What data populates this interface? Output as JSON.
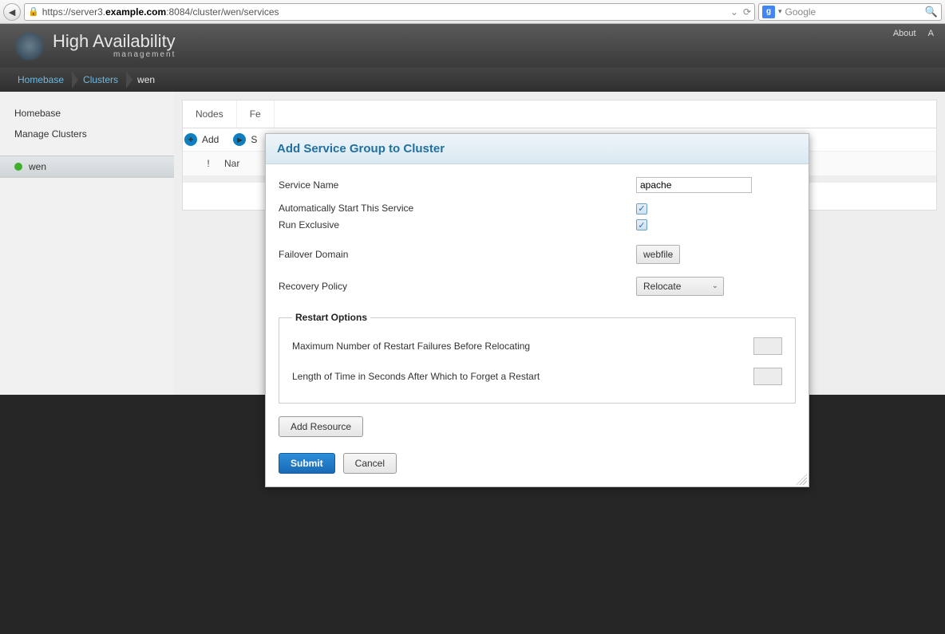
{
  "browser": {
    "url_prefix": "https://",
    "url_host_pre": "server3.",
    "url_host_bold": "example.com",
    "url_rest": ":8084/cluster/wen/services",
    "search_engine": "g",
    "search_placeholder": "Google"
  },
  "header": {
    "title": "High Availability",
    "subtitle": "management",
    "links": [
      "About",
      "A"
    ]
  },
  "breadcrumbs": [
    "Homebase",
    "Clusters",
    "wen"
  ],
  "sidebar": {
    "items": [
      "Homebase",
      "Manage Clusters"
    ],
    "cluster": "wen"
  },
  "tabs": [
    "Nodes",
    "Fe"
  ],
  "toolbar": {
    "add_label": "Add",
    "start_label": "S"
  },
  "table": {
    "col_bang": "!",
    "col_name": "Nar"
  },
  "modal": {
    "title": "Add Service Group to Cluster",
    "fields": {
      "service_name_label": "Service Name",
      "service_name_value": "apache",
      "auto_start_label": "Automatically Start This Service",
      "auto_start_checked": true,
      "exclusive_label": "Run Exclusive",
      "exclusive_checked": true,
      "failover_label": "Failover Domain",
      "failover_value": "webfile",
      "recovery_label": "Recovery Policy",
      "recovery_value": "Relocate"
    },
    "restart": {
      "legend": "Restart Options",
      "max_label": "Maximum Number of Restart Failures Before Relocating",
      "time_label": "Length of Time in Seconds After Which to Forget a Restart"
    },
    "add_resource": "Add Resource",
    "submit": "Submit",
    "cancel": "Cancel"
  }
}
